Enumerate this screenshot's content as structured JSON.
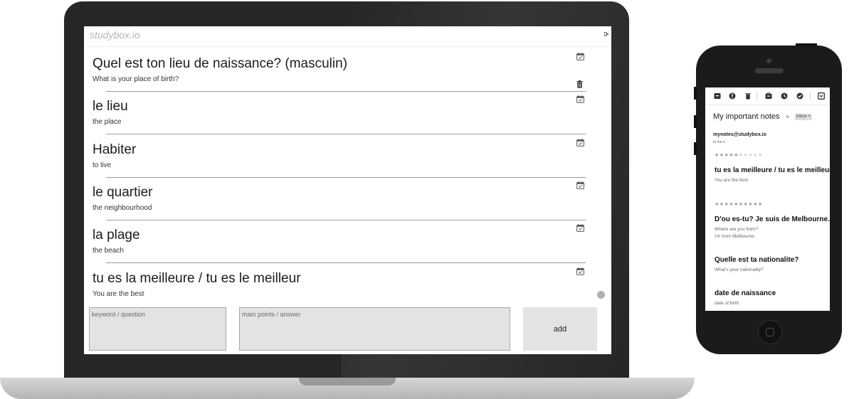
{
  "laptop_app": {
    "brand": "studybox.io",
    "cards": [
      {
        "question": "Quel est ton lieu de naissance? (masculin)",
        "answer": "What is your place of birth?"
      },
      {
        "question": "le lieu",
        "answer": "the place"
      },
      {
        "question": "Habiter",
        "answer": "to live"
      },
      {
        "question": "le quartier",
        "answer": "the neighbourhood"
      },
      {
        "question": "la plage",
        "answer": "the beach"
      },
      {
        "question": "tu es la meilleure / tu es le meilleur",
        "answer": "You are the best"
      }
    ],
    "form": {
      "keyword_placeholder": "keyword / question",
      "answer_placeholder": "main points / answer",
      "add_label": "add"
    }
  },
  "phone_mail": {
    "toolbar_icons": [
      "archive-icon",
      "report-icon",
      "delete-icon",
      "move-to-icon",
      "snooze-icon",
      "mark-done-icon",
      "more-icon"
    ],
    "subject": "My important notes",
    "label_chip": "Inbox ×",
    "sender": "mynotes@studybox.io",
    "recipient": "to me ▾",
    "notes": [
      {
        "stars": "★★★★★★★★★★",
        "stars_filled": 5,
        "title": "tu es la meilleure / tu es le meilleur",
        "body": "You are the best"
      },
      {
        "stars": "★★★★★★★★★★",
        "stars_filled": 10,
        "title": "D'ou es-tu? Je suis de Melbourne.",
        "body": "Where are you from?\nI'm from Melbourne."
      },
      {
        "title": "Quelle est ta nationalite?",
        "body": "What's your nationality?"
      },
      {
        "title": "date de naissance",
        "body": "date of birth"
      }
    ]
  },
  "colors": {
    "device_body": "#262626",
    "input_bg": "#e3e3e3",
    "divider": "#9b9b9b",
    "brand_text": "#b5b5b5"
  }
}
